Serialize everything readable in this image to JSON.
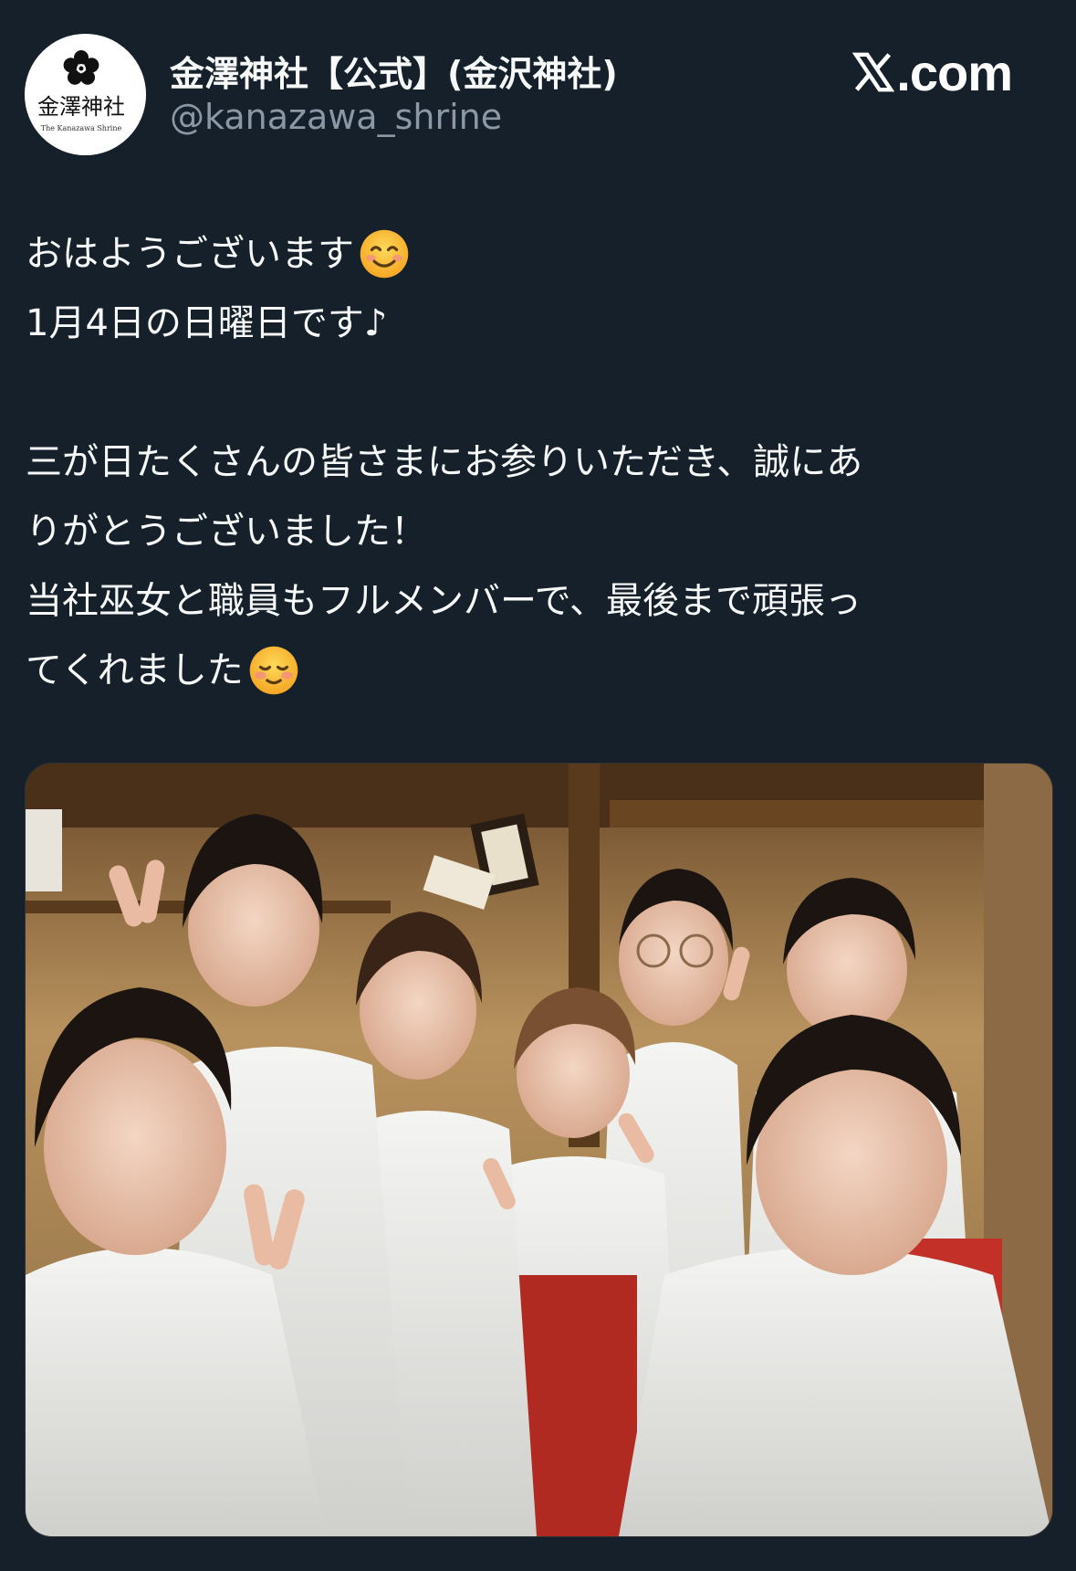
{
  "header": {
    "account_name": "金澤神社【公式】(金沢神社)",
    "handle": "@kanazawa_shrine",
    "avatar": {
      "icon": "shrine-crest-logo",
      "logo_text_jp": "金澤神社",
      "logo_text_en": "The Kanazawa Shrine"
    },
    "brand": {
      "icon": "x-logo-icon",
      "text": ".com"
    }
  },
  "tweet": {
    "lines": [
      "おはようございます",
      "1月4日の日曜日です♪",
      "三が日たくさんの皆さまにお参りいただき、誠にあ",
      "りがとうございました！",
      "当社巫女と職員もフルメンバーで、最後まで頑張っ",
      "てくれました"
    ],
    "emojis": [
      "smiling-face-emoji",
      "relieved-smiling-face-emoji"
    ]
  },
  "media": {
    "type": "photo",
    "icon": "photo-image"
  },
  "colors": {
    "background": "#15202b",
    "text_primary": "#f7f9f9",
    "text_secondary": "#8b98a5"
  }
}
